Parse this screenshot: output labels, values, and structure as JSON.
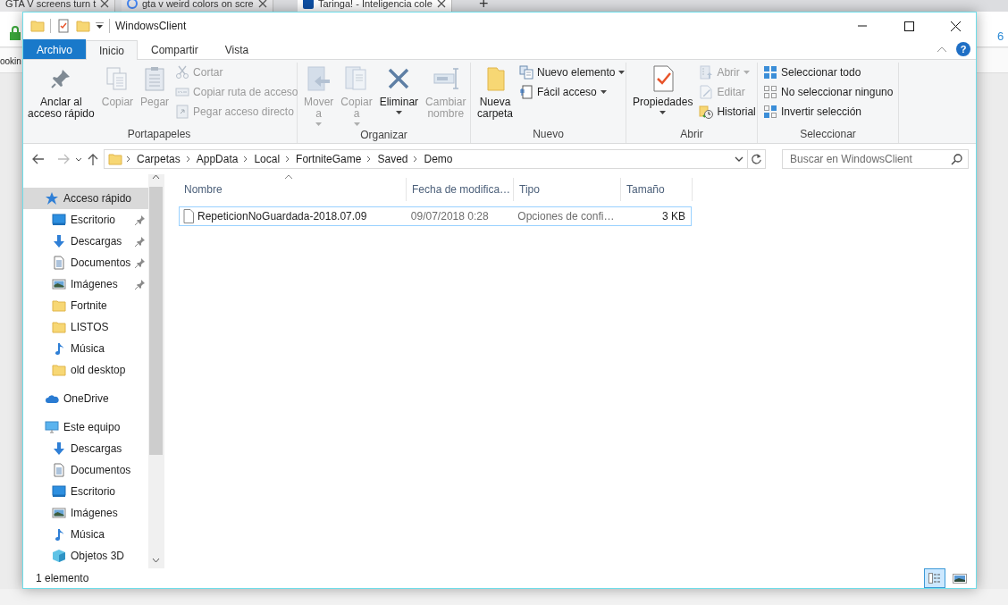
{
  "browser": {
    "tabs": [
      {
        "title": "GTA V screens turn t",
        "selected": false
      },
      {
        "title": "gta v weird colors on scre",
        "selected": false
      },
      {
        "title": "Taringa! - Inteligencia cole",
        "selected": true
      }
    ],
    "new_tab": "+",
    "side_text": "ookin",
    "counter": "6"
  },
  "window": {
    "title": "WindowsClient"
  },
  "ribbon_tabs": [
    {
      "label": "Archivo",
      "kind": "file",
      "selected": false
    },
    {
      "label": "Inicio",
      "kind": "tab",
      "selected": true
    },
    {
      "label": "Compartir",
      "kind": "tab",
      "selected": false
    },
    {
      "label": "Vista",
      "kind": "tab",
      "selected": false
    }
  ],
  "help": "?",
  "ribbon_groups": [
    {
      "label": "Portapapeles",
      "items": [
        {
          "kind": "large",
          "label": "Anclar al\nacceso rápido",
          "disabled": false,
          "dropdown": false
        },
        {
          "kind": "large",
          "label": "Copiar",
          "disabled": true,
          "dropdown": false
        },
        {
          "kind": "large",
          "label": "Pegar",
          "disabled": true,
          "dropdown": false
        },
        {
          "kind": "small",
          "label": "Cortar",
          "disabled": true,
          "dropdown": false
        },
        {
          "kind": "small",
          "label": "Copiar ruta de acceso",
          "disabled": true,
          "dropdown": false
        },
        {
          "kind": "small",
          "label": "Pegar acceso directo",
          "disabled": true,
          "dropdown": false
        }
      ]
    },
    {
      "label": "Organizar",
      "items": [
        {
          "kind": "large",
          "label": "Mover\na",
          "disabled": true,
          "dropdown": true
        },
        {
          "kind": "large",
          "label": "Copiar\na",
          "disabled": true,
          "dropdown": true
        },
        {
          "kind": "large",
          "label": "Eliminar",
          "disabled": false,
          "dropdown": true
        },
        {
          "kind": "large",
          "label": "Cambiar\nnombre",
          "disabled": true,
          "dropdown": false
        }
      ]
    },
    {
      "label": "Nuevo",
      "items": [
        {
          "kind": "large",
          "label": "Nueva\ncarpeta",
          "disabled": false,
          "dropdown": false
        },
        {
          "kind": "small",
          "label": "Nuevo elemento",
          "disabled": false,
          "dropdown": true
        },
        {
          "kind": "small",
          "label": "Fácil acceso",
          "disabled": false,
          "dropdown": true
        }
      ]
    },
    {
      "label": "Abrir",
      "items": [
        {
          "kind": "large",
          "label": "Propiedades",
          "disabled": false,
          "dropdown": true
        },
        {
          "kind": "small",
          "label": "Abrir",
          "disabled": true,
          "dropdown": true
        },
        {
          "kind": "small",
          "label": "Editar",
          "disabled": true,
          "dropdown": false
        },
        {
          "kind": "small",
          "label": "Historial",
          "disabled": false,
          "dropdown": false
        }
      ]
    },
    {
      "label": "Seleccionar",
      "items": [
        {
          "kind": "small",
          "label": "Seleccionar todo",
          "disabled": false,
          "dropdown": false
        },
        {
          "kind": "small",
          "label": "No seleccionar ninguno",
          "disabled": false,
          "dropdown": false
        },
        {
          "kind": "small",
          "label": "Invertir selección",
          "disabled": false,
          "dropdown": false
        }
      ]
    }
  ],
  "address": {
    "path": [
      "Carpetas",
      "AppData",
      "Local",
      "FortniteGame",
      "Saved",
      "Demo"
    ]
  },
  "search": {
    "placeholder": "Buscar en WindowsClient"
  },
  "sidebar": {
    "items": [
      {
        "label": "Acceso rápido",
        "selected": true,
        "children": [
          {
            "label": "Escritorio",
            "pinned": true,
            "selected": false
          },
          {
            "label": "Descargas",
            "pinned": true,
            "selected": false
          },
          {
            "label": "Documentos",
            "pinned": true,
            "selected": false
          },
          {
            "label": "Imágenes",
            "pinned": true,
            "selected": false
          },
          {
            "label": "Fortnite",
            "pinned": false,
            "selected": false
          },
          {
            "label": "LISTOS",
            "pinned": false,
            "selected": false
          },
          {
            "label": "Música",
            "pinned": false,
            "selected": false
          },
          {
            "label": "old desktop",
            "pinned": false,
            "selected": false
          }
        ]
      },
      {
        "label": "OneDrive",
        "selected": false
      },
      {
        "label": "Este equipo",
        "selected": false,
        "children": [
          {
            "label": "Descargas",
            "pinned": false,
            "selected": false
          },
          {
            "label": "Documentos",
            "pinned": false,
            "selected": false
          },
          {
            "label": "Escritorio",
            "pinned": false,
            "selected": false
          },
          {
            "label": "Imágenes",
            "pinned": false,
            "selected": false
          },
          {
            "label": "Música",
            "pinned": false,
            "selected": false
          },
          {
            "label": "Objetos 3D",
            "pinned": false,
            "selected": false
          }
        ]
      }
    ]
  },
  "table": {
    "columns": [
      "Nombre",
      "Fecha de modifica…",
      "Tipo",
      "Tamaño"
    ],
    "rows": [
      {
        "cells": [
          "RepeticionNoGuardada-2018.07.09",
          "09/07/2018 0:28",
          "Opciones de confi…",
          "3 KB"
        ],
        "focused": true
      }
    ]
  },
  "status_bar": {
    "text": "1 elemento",
    "views": [
      {
        "kind": "details",
        "selected": true
      },
      {
        "kind": "large-icons",
        "selected": false
      }
    ]
  }
}
